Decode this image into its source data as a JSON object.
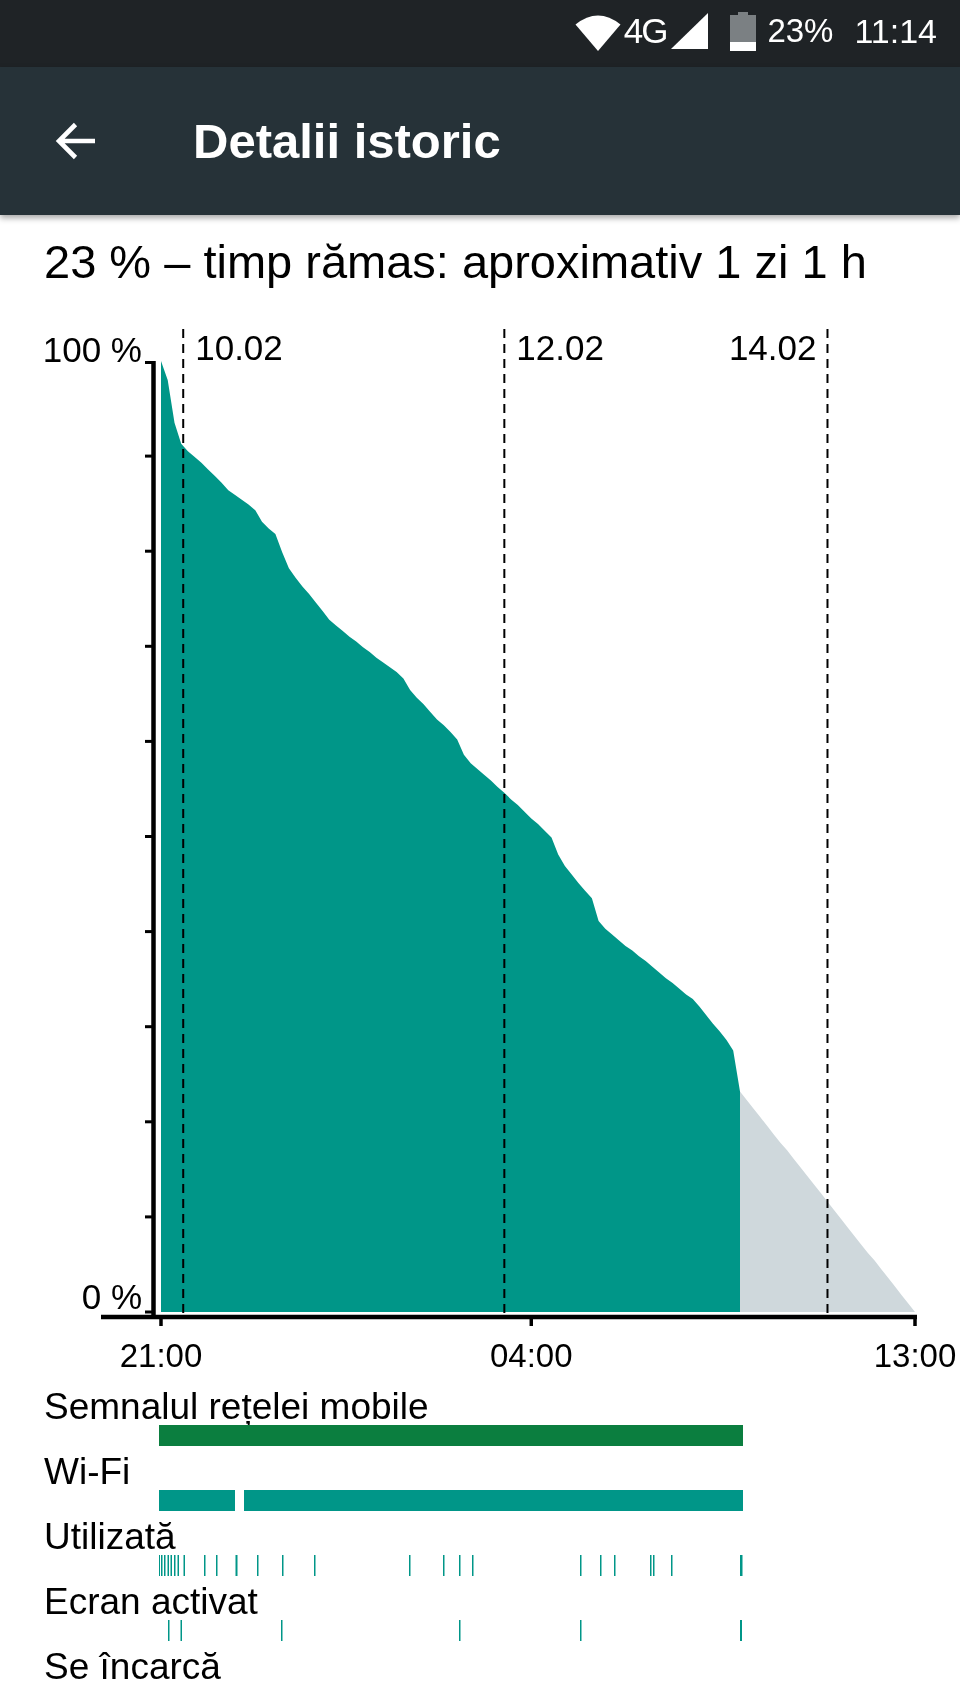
{
  "status_bar": {
    "network_type": "4G",
    "battery": "23%",
    "time": "11:14"
  },
  "app_bar": {
    "title": "Detalii istoric"
  },
  "summary": "23 % – timp rămas: aproximativ 1 zi 1 h",
  "chart": {
    "chart_data": {
      "type": "area",
      "categories": [
        "21:00",
        null,
        null,
        null,
        null,
        null,
        null,
        null,
        null,
        null,
        null,
        null,
        null,
        null,
        null,
        null,
        null,
        null,
        null,
        null,
        null,
        null,
        null,
        null,
        null,
        null,
        null,
        null,
        null,
        null,
        null,
        null,
        null,
        null,
        null,
        null,
        null,
        null,
        null,
        null,
        null,
        null,
        null,
        null,
        null,
        null,
        null,
        null,
        null,
        null,
        null,
        null,
        null,
        null,
        null,
        "04:00",
        null,
        null,
        null,
        null,
        null,
        null,
        null,
        null,
        null,
        null,
        null,
        null,
        null,
        null,
        null,
        null,
        null,
        null,
        null,
        null,
        null,
        null,
        null,
        null,
        null,
        null,
        null,
        null,
        null,
        null,
        null,
        null,
        null,
        null,
        null,
        null,
        null,
        null,
        null,
        null,
        null,
        null,
        null,
        null,
        null,
        null,
        null,
        null,
        null,
        null,
        null,
        null,
        null,
        null,
        null,
        null,
        "13:00"
      ],
      "series": [
        {
          "color": "#009688",
          "values": [
            100,
            98,
            93.5,
            91.3,
            90.5,
            89.9,
            89.3,
            88.6,
            87.9,
            87.2,
            86.4,
            85.9,
            85.4,
            84.9,
            84.3,
            83.1,
            82.4,
            81.8,
            79.9,
            78.2,
            77.2,
            76.3,
            75.5,
            74.6,
            73.7,
            72.8,
            72.2,
            71.6,
            71,
            70.5,
            69.9,
            69.4,
            68.8,
            68.3,
            67.8,
            67.3,
            66.6,
            65.4,
            64.6,
            63.9,
            63.1,
            62.3,
            61.7,
            61,
            60.2,
            58.6,
            57.7,
            57.1,
            56.5,
            55.9,
            55.2,
            54.6,
            53.9,
            53.3,
            52.6,
            51.9,
            51.3,
            50.6,
            49.9,
            48.1,
            46.9,
            46,
            45.1,
            44.3,
            43.5,
            41.1,
            40.3,
            39.7,
            39.1,
            38.5,
            38,
            37.4,
            36.9,
            36.3,
            35.7,
            35.1,
            34.6,
            34,
            33.4,
            32.9,
            32.1,
            31.2,
            30.3,
            29.5,
            28.6,
            27.5,
            23.2,
            null,
            null,
            null,
            null,
            null,
            null,
            null,
            null,
            null,
            null,
            null,
            null,
            null,
            null,
            null,
            null,
            null,
            null,
            null,
            null,
            null,
            null,
            null,
            null,
            null,
            null
          ]
        },
        {
          "color": "#cfd8dc",
          "values": [
            null,
            null,
            null,
            null,
            null,
            null,
            null,
            null,
            null,
            null,
            null,
            null,
            null,
            null,
            null,
            null,
            null,
            null,
            null,
            null,
            null,
            null,
            null,
            null,
            null,
            null,
            null,
            null,
            null,
            null,
            null,
            null,
            null,
            null,
            null,
            null,
            null,
            null,
            null,
            null,
            null,
            null,
            null,
            null,
            null,
            null,
            null,
            null,
            null,
            null,
            null,
            null,
            null,
            null,
            null,
            null,
            null,
            null,
            null,
            null,
            null,
            null,
            null,
            null,
            null,
            null,
            null,
            null,
            null,
            null,
            null,
            null,
            null,
            null,
            null,
            null,
            null,
            null,
            null,
            null,
            null,
            null,
            null,
            null,
            null,
            null,
            23.2,
            22.3,
            21.4,
            20.5,
            19.6,
            18.7,
            17.8,
            17,
            16.1,
            15.2,
            14.3,
            13.4,
            12.5,
            11.6,
            10.7,
            9.8,
            8.9,
            8,
            7.1,
            6.2,
            5.4,
            4.5,
            3.6,
            2.7,
            1.8,
            0.9,
            0
          ]
        }
      ],
      "ylim": [
        0,
        100
      ],
      "yticks": [
        {
          "value": 0,
          "label": "0 %"
        },
        {
          "value": 100,
          "label": "100 %"
        }
      ],
      "annotations": [
        "10.02",
        "12.02",
        "14.02"
      ]
    }
  },
  "tracks": [
    {
      "label": "Semnalul rețelei mobile",
      "color": "#0b7e3f"
    },
    {
      "label": "Wi-Fi",
      "color": "#009688"
    },
    {
      "label": "Utilizată",
      "color": "#009688"
    },
    {
      "label": "Ecran activat",
      "color": "#009688"
    },
    {
      "label": "Se încarcă"
    }
  ]
}
